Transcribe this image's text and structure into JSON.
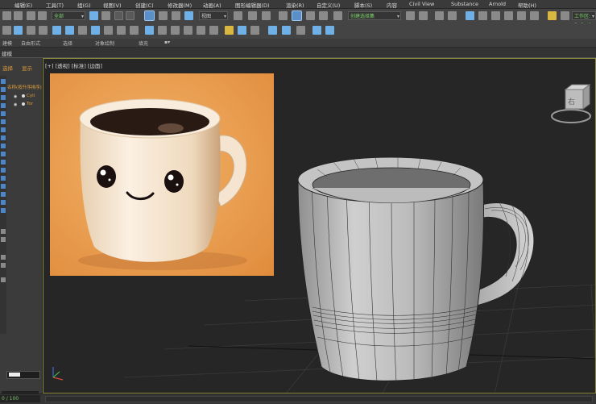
{
  "menu": {
    "items": [
      "编辑(E)",
      "工具(T)",
      "组(G)",
      "视图(V)",
      "创建(C)",
      "修改器(M)",
      "动画(A)",
      "图形编辑器(D)",
      "渲染(R)",
      "自定义(U)",
      "脚本(S)",
      "内容",
      "Civil View",
      "Substance",
      "Arnold",
      "帮助(H)"
    ]
  },
  "toolbar": {
    "selection_filter": "全部",
    "view_coord": "视图",
    "named_selection": "创建选择集",
    "workspace": "工作区: Default"
  },
  "ribbon": {
    "labels": [
      "建模",
      "自由形式",
      "选择",
      "对象绘制",
      "填充"
    ]
  },
  "modebar": {
    "label": "建模"
  },
  "scene_explorer": {
    "tab_select": "选择",
    "tab_display": "显示",
    "column_header": "名称(按升序排序)",
    "rows": [
      {
        "name": "Cyli"
      },
      {
        "name": "Tor"
      }
    ]
  },
  "viewport": {
    "label": "[+] [透视] [标准] [边面]",
    "viewcube_face": "右"
  },
  "status": {
    "mini_listener": "0 / 100"
  },
  "colors": {
    "accent_blue": "#3a7ec6",
    "selection_orange": "#e09b3a",
    "viewport_border": "#8a8a3a",
    "dropdown_green": "#7ad16a"
  }
}
